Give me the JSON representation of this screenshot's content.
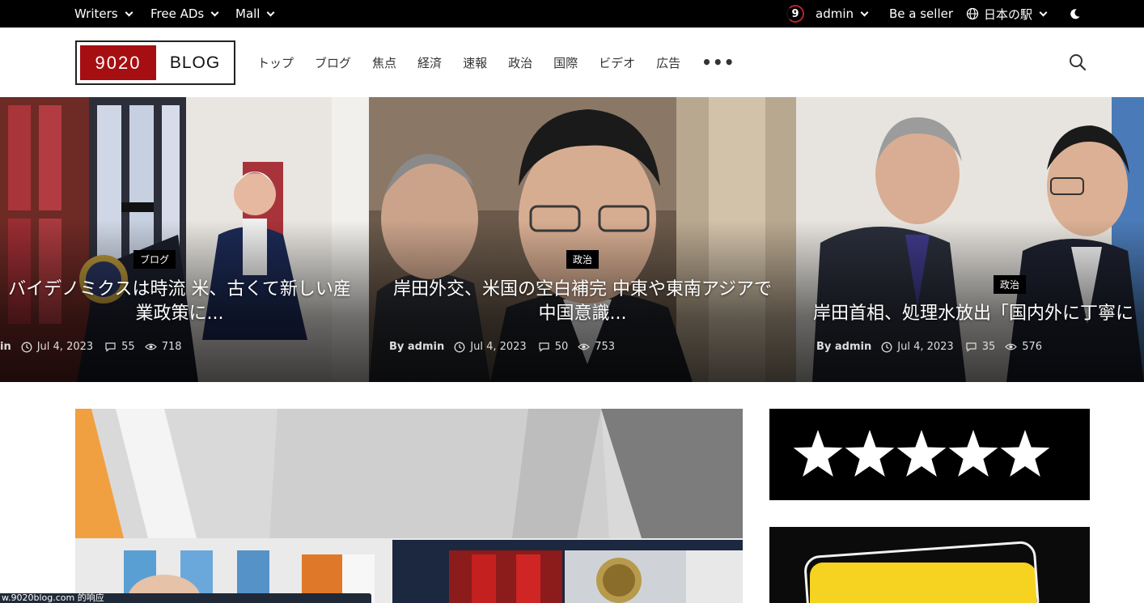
{
  "topbar": {
    "writers": "Writers",
    "free_ads": "Free ADs",
    "mall": "Mall",
    "avatar_glyph": "9",
    "user": "admin",
    "be_seller": "Be a seller",
    "language": "日本の駅"
  },
  "header": {
    "logo_left": "9020",
    "logo_right": "BLOG",
    "nav": [
      "トップ",
      "ブログ",
      "焦点",
      "経済",
      "速報",
      "政治",
      "国際",
      "ビデオ",
      "広告"
    ],
    "more": "•••"
  },
  "slides": [
    {
      "category": "ブログ",
      "title_line1": "バイデノミクスは時流 米、古くて新しい産",
      "title_line2": "業政策に...",
      "author": "in",
      "date": "Jul 4, 2023",
      "comments": "55",
      "views": "718"
    },
    {
      "category": "政治",
      "title_line1": "岸田外交、米国の空白補完 中東や東南アジアで",
      "title_line2": "中国意識...",
      "author": "By admin",
      "date": "Jul 4, 2023",
      "comments": "50",
      "views": "753"
    },
    {
      "category": "政治",
      "title_line1": "岸田首相、処理水放出「国内外に丁寧に",
      "author": "By admin",
      "date": "Jul 4, 2023",
      "comments": "35",
      "views": "576"
    }
  ],
  "ads": {
    "rating_stars": 5
  },
  "statusbar": {
    "text": "w.9020blog.com 的响应"
  },
  "colors": {
    "topbar_bg": "#000000",
    "logo_red": "#a50f12",
    "badge_bg": "#000000",
    "ad_yellow": "#f5d320"
  }
}
